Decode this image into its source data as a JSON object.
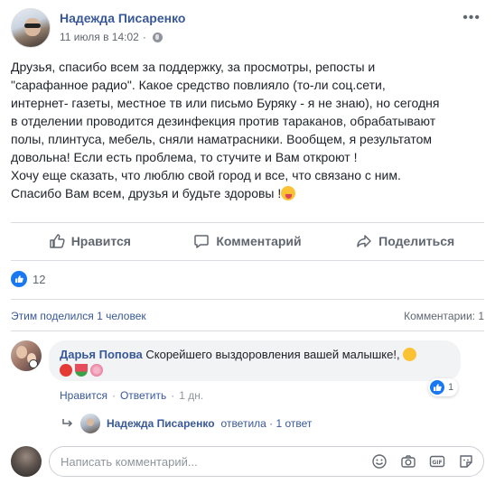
{
  "post": {
    "author": "Надежда Писаренко",
    "date": "11 июля в 14:02",
    "separator": "·",
    "text_lines": [
      "Друзья, спасибо всем за поддержку, за просмотры, репосты и",
      "\"сарафанное радио\". Какое средство повлияло (то-ли соц.сети,",
      "интернет- газеты, местное тв или письмо Буряку - я не знаю), но сегодня",
      "в отделении проводится дезинфекция против тараканов, обрабатывают",
      "полы, плинтуса, мебель, сняли наматрасники. Вообщем, я результатом",
      "довольна! Если есть проблема, то стучите и Вам откроют !",
      "Хочу еще сказать, что люблю свой город и все, что связано с ним.",
      "Спасибо Вам всем, друзья и будьте здоровы !"
    ]
  },
  "actions": {
    "like": "Нравится",
    "comment": "Комментарий",
    "share": "Поделиться"
  },
  "reactions": {
    "count": "12"
  },
  "stats": {
    "shared_by": "Этим поделился 1 человек",
    "comments": "Комментарии: 1"
  },
  "comment": {
    "author": "Дарья Попова",
    "text": "Скорейшего выздоровления вашей малышке!,",
    "like_count": "1",
    "actions": {
      "like": "Нравится",
      "reply": "Ответить",
      "time": "1 дн.",
      "dot": "·"
    }
  },
  "reply": {
    "name": "Надежда Писаренко",
    "text": "ответила · 1 ответ"
  },
  "composer": {
    "placeholder": "Написать комментарий..."
  },
  "colors": {
    "link": "#385898",
    "like_blue": "#1877f2",
    "muted": "#606770"
  },
  "icons": [
    "globe-icon",
    "more-options-icon",
    "thumbs-up-icon",
    "comment-icon",
    "share-icon",
    "reply-arrow-icon",
    "smile-icon",
    "camera-icon",
    "gif-icon",
    "sticker-icon"
  ]
}
